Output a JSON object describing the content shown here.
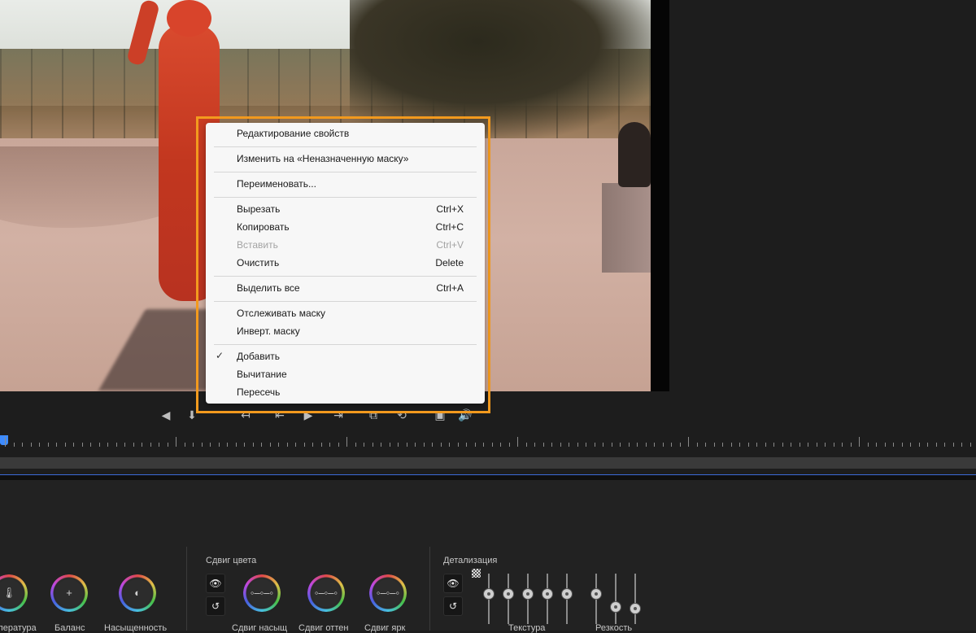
{
  "context_menu": {
    "items": [
      {
        "label": "Редактирование свойств",
        "shortcut": ""
      },
      {
        "label": "Изменить на «Неназначенную маску»",
        "shortcut": ""
      },
      {
        "label": "Переименовать...",
        "shortcut": ""
      },
      {
        "label": "Вырезать",
        "shortcut": "Ctrl+X"
      },
      {
        "label": "Копировать",
        "shortcut": "Ctrl+C"
      },
      {
        "label": "Вставить",
        "shortcut": "Ctrl+V",
        "disabled": true
      },
      {
        "label": "Очистить",
        "shortcut": "Delete"
      },
      {
        "label": "Выделить все",
        "shortcut": "Ctrl+A"
      },
      {
        "label": "Отслеживать маску",
        "shortcut": ""
      },
      {
        "label": "Инверт. маску",
        "shortcut": ""
      },
      {
        "label": "Добавить",
        "shortcut": "",
        "checked": true
      },
      {
        "label": "Вычитание",
        "shortcut": ""
      },
      {
        "label": "Пересечь",
        "shortcut": ""
      }
    ],
    "check_glyph": "✓",
    "highlight_color": "#f39a1e"
  },
  "color_panel": {
    "wheels_left": [
      {
        "label": "Температура",
        "icon": "thermometer-icon",
        "glyph": "🌡"
      },
      {
        "label": "Баланс",
        "icon": "plus-icon",
        "glyph": "+"
      },
      {
        "label": "Насыщенность",
        "icon": "saturation-icon",
        "glyph": "◐"
      }
    ],
    "color_shift": {
      "title": "Сдвиг цвета",
      "wheels": [
        {
          "label": "Сдвиг насыщ"
        },
        {
          "label": "Сдвиг оттен"
        },
        {
          "label": "Сдвиг ярк"
        }
      ]
    },
    "detail": {
      "title": "Детализация",
      "texture_label": "Текстура",
      "sharpness_label": "Резкость"
    },
    "eye_glyph": "👁",
    "reset_glyph": "↺"
  },
  "controls": {
    "icons": [
      "mark-in-icon",
      "marker-icon",
      "step-back-icon",
      "go-to-in-icon",
      "play-icon",
      "go-to-out-icon",
      "export-frame-icon",
      "loop-icon",
      "safe-margins-icon",
      "volume-icon"
    ],
    "glyphs": [
      "◀",
      "⬇",
      "↤",
      "⇤",
      "▶",
      "⇥",
      "⧉",
      "⟲",
      "▣",
      "🔊"
    ]
  },
  "accent": {
    "playhead": "#3d8bff"
  }
}
